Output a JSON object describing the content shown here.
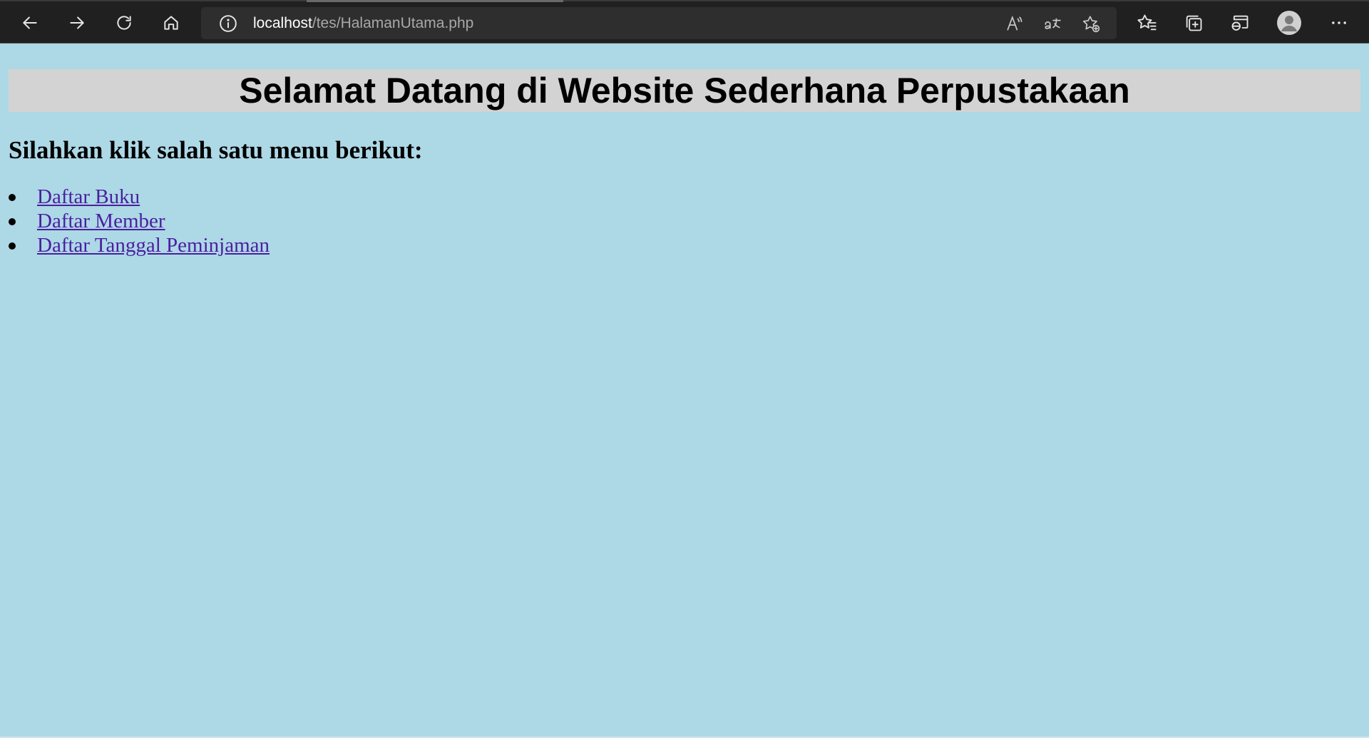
{
  "browser": {
    "address_bar": {
      "host": "localhost",
      "path": "/tes/HalamanUtama.php"
    },
    "icons": {
      "back": "back-arrow-icon",
      "forward": "forward-arrow-icon",
      "refresh": "refresh-icon",
      "home": "home-icon",
      "site_info": "info-icon",
      "read_aloud": "read-aloud-icon",
      "translate": "translate-icon",
      "add_favorite": "add-favorite-icon",
      "favorites": "favorites-icon",
      "collections": "collections-icon",
      "ie_mode": "ie-mode-icon",
      "profile": "profile-avatar-icon",
      "menu": "more-menu-icon"
    },
    "theme": {
      "toolbar_bg": "#202020",
      "address_bg": "#2e2e2e"
    }
  },
  "page": {
    "banner_title": "Selamat Datang di Website Sederhana Perpustakaan",
    "instruction": "Silahkan klik salah satu menu berikut:",
    "menu": [
      {
        "label": "Daftar Buku"
      },
      {
        "label": "Daftar Member"
      },
      {
        "label": "Daftar Tanggal Peminjaman"
      }
    ],
    "colors": {
      "background": "#add8e6",
      "banner_bg": "#d3d3d3",
      "link": "#4b1fa0"
    }
  }
}
